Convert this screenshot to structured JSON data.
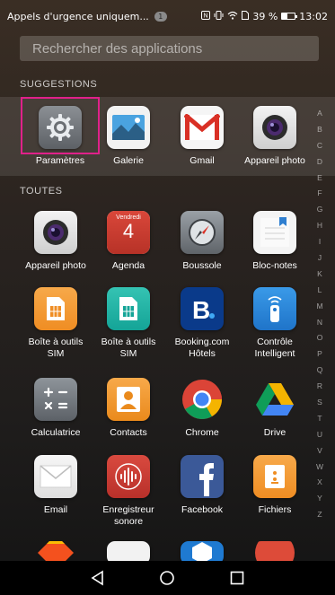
{
  "status": {
    "notification": "Appels d'urgence uniquem...",
    "notif_count": "1",
    "icons": [
      "nfc-icon",
      "vibrate-icon",
      "wifi-icon",
      "sim-icon"
    ],
    "battery": "39 %",
    "time": "13:02"
  },
  "search": {
    "placeholder": "Rechercher des applications"
  },
  "sections": {
    "suggestions": "SUGGESTIONS",
    "all": "TOUTES"
  },
  "suggestions": [
    {
      "label": "Paramètres",
      "icon": "settings-icon"
    },
    {
      "label": "Galerie",
      "icon": "gallery-icon"
    },
    {
      "label": "Gmail",
      "icon": "gmail-icon"
    },
    {
      "label": "Appareil photo",
      "icon": "camera-icon"
    }
  ],
  "apps": [
    {
      "label": "Appareil photo",
      "icon": "camera-icon"
    },
    {
      "label": "Agenda",
      "icon": "calendar-icon",
      "day_name": "Vendredi",
      "day_num": "4"
    },
    {
      "label": "Boussole",
      "icon": "compass-icon"
    },
    {
      "label": "Bloc-notes",
      "icon": "notepad-icon"
    },
    {
      "label": "Boîte à outils\nSIM",
      "icon": "sim-toolkit-icon"
    },
    {
      "label": "Boîte à outils\nSIM",
      "icon": "sim-toolkit-icon"
    },
    {
      "label": "Booking.com\nHôtels",
      "icon": "booking-icon"
    },
    {
      "label": "Contrôle\nIntelligent",
      "icon": "remote-icon"
    },
    {
      "label": "Calculatrice",
      "icon": "calculator-icon"
    },
    {
      "label": "Contacts",
      "icon": "contacts-icon"
    },
    {
      "label": "Chrome",
      "icon": "chrome-icon"
    },
    {
      "label": "Drive",
      "icon": "drive-icon"
    },
    {
      "label": "Email",
      "icon": "email-icon"
    },
    {
      "label": "Enregistreur\nsonore",
      "icon": "recorder-icon"
    },
    {
      "label": "Facebook",
      "icon": "facebook-icon"
    },
    {
      "label": "Fichiers",
      "icon": "files-icon"
    }
  ],
  "alphabet": [
    "A",
    "B",
    "C",
    "D",
    "E",
    "F",
    "G",
    "H",
    "I",
    "J",
    "K",
    "L",
    "M",
    "N",
    "O",
    "P",
    "Q",
    "R",
    "S",
    "T",
    "U",
    "V",
    "W",
    "X",
    "Y",
    "Z"
  ],
  "nav": [
    "back-icon",
    "home-icon",
    "recents-icon"
  ]
}
